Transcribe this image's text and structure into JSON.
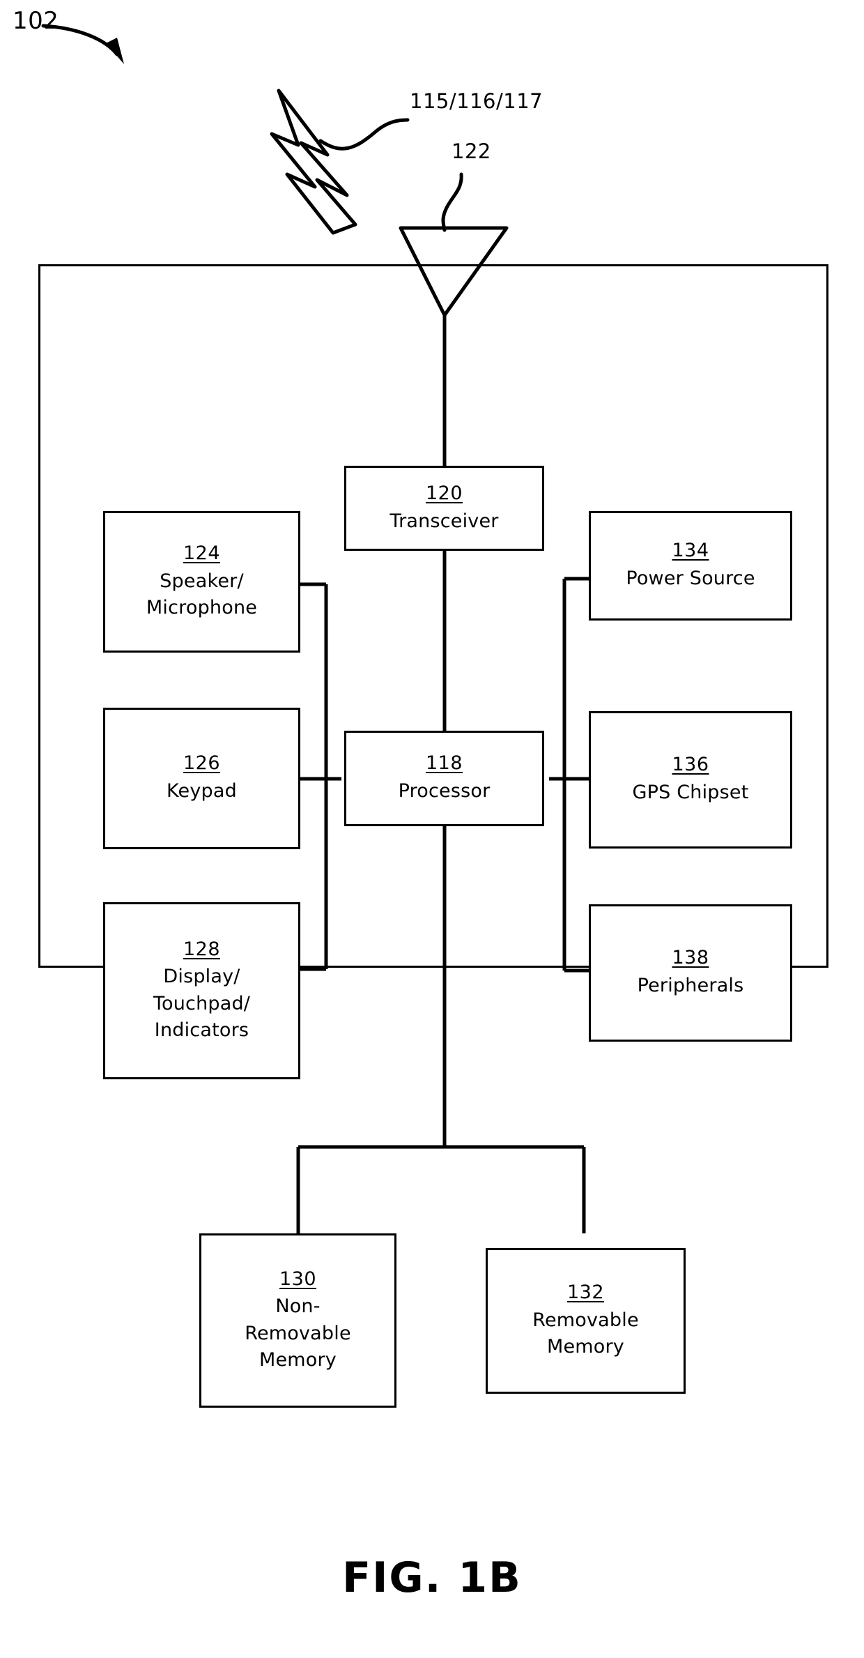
{
  "figure": {
    "caption": "FIG. 1B",
    "device_ref": "102"
  },
  "annotations": {
    "device_label": "102",
    "air_interface_label": "115/116/117",
    "antenna_label": "122"
  },
  "icons": {
    "lightning": "lightning-bolt-icon",
    "antenna": "antenna-triangle-icon",
    "curve_arrow": "curved-arrow-icon"
  },
  "blocks": [
    {
      "id": "transceiver",
      "ref": "120",
      "label": "Transceiver"
    },
    {
      "id": "speaker",
      "ref": "124",
      "label": "Speaker/\nMicrophone"
    },
    {
      "id": "keypad",
      "ref": "126",
      "label": "Keypad"
    },
    {
      "id": "display",
      "ref": "128",
      "label": "Display/\nTouchpad/\nIndicators"
    },
    {
      "id": "processor",
      "ref": "118",
      "label": "Processor"
    },
    {
      "id": "power",
      "ref": "134",
      "label": "Power Source"
    },
    {
      "id": "gps",
      "ref": "136",
      "label": "GPS Chipset"
    },
    {
      "id": "peripherals",
      "ref": "138",
      "label": "Peripherals"
    },
    {
      "id": "nonremovable",
      "ref": "130",
      "label": "Non-\nRemovable\nMemory"
    },
    {
      "id": "removable",
      "ref": "132",
      "label": "Removable\nMemory"
    }
  ],
  "colors": {
    "stroke": "#000000",
    "background": "#ffffff"
  }
}
